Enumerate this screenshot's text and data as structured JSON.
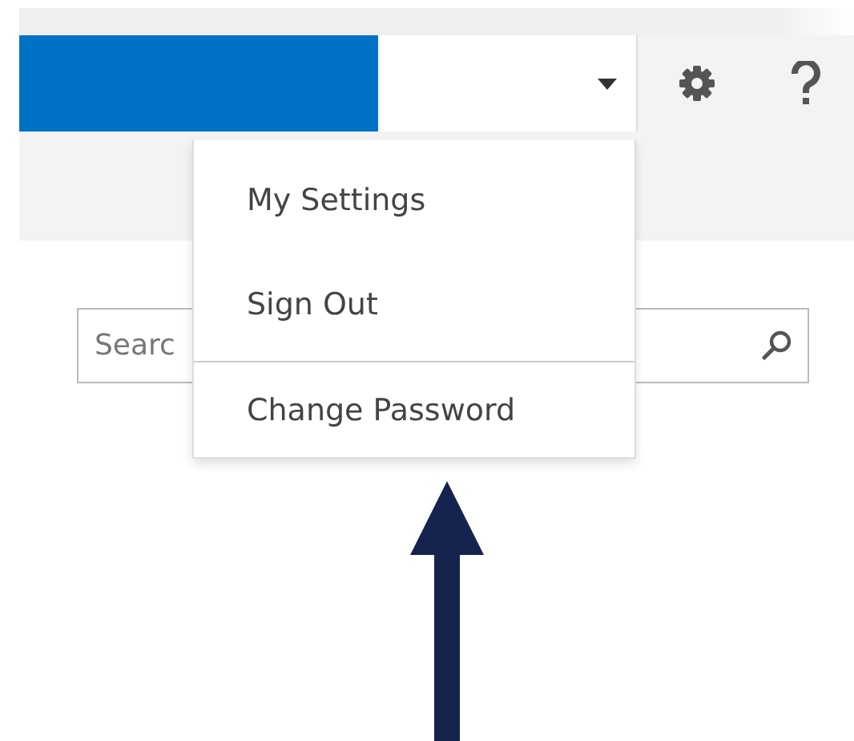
{
  "header": {
    "user_menu": {
      "expanded": true,
      "items": [
        {
          "label": "My Settings",
          "separator_before": false
        },
        {
          "label": "Sign Out",
          "separator_before": false
        },
        {
          "label": "Change Password",
          "separator_before": true
        }
      ]
    }
  },
  "search": {
    "placeholder": "Searc"
  }
}
